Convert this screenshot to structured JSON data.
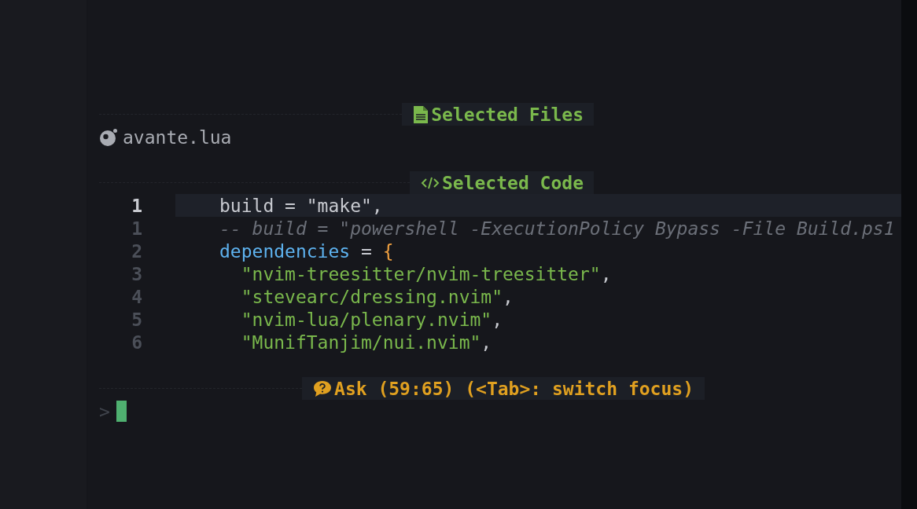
{
  "files_section": {
    "title": "Selected Files",
    "files": [
      "avante.lua"
    ]
  },
  "code_section": {
    "title": "Selected Code",
    "lines": [
      {
        "number": "1",
        "current": true,
        "tokens": [
          {
            "text": "build = \"make\",",
            "kind": "plain"
          }
        ]
      },
      {
        "number": "1",
        "current": false,
        "tokens": [
          {
            "text": "-- build = \"powershell -ExecutionPolicy Bypass -File Build.ps1",
            "kind": "comment"
          }
        ]
      },
      {
        "number": "2",
        "current": false,
        "tokens": [
          {
            "text": "dependencies",
            "kind": "key"
          },
          {
            "text": " = ",
            "kind": "plain"
          },
          {
            "text": "{",
            "kind": "brace"
          }
        ]
      },
      {
        "number": "3",
        "current": false,
        "tokens": [
          {
            "text": "  \"nvim-treesitter/nvim-treesitter\"",
            "kind": "string"
          },
          {
            "text": ",",
            "kind": "plain"
          }
        ]
      },
      {
        "number": "4",
        "current": false,
        "tokens": [
          {
            "text": "  \"stevearc/dressing.nvim\"",
            "kind": "string"
          },
          {
            "text": ",",
            "kind": "plain"
          }
        ]
      },
      {
        "number": "5",
        "current": false,
        "tokens": [
          {
            "text": "  \"nvim-lua/plenary.nvim\"",
            "kind": "string"
          },
          {
            "text": ",",
            "kind": "plain"
          }
        ]
      },
      {
        "number": "6",
        "current": false,
        "tokens": [
          {
            "text": "  \"MunifTanjim/nui.nvim\"",
            "kind": "string"
          },
          {
            "text": ",",
            "kind": "plain"
          }
        ]
      }
    ]
  },
  "ask_section": {
    "title": "Ask (59:65) (<Tab>: switch focus)",
    "prompt": ">"
  }
}
